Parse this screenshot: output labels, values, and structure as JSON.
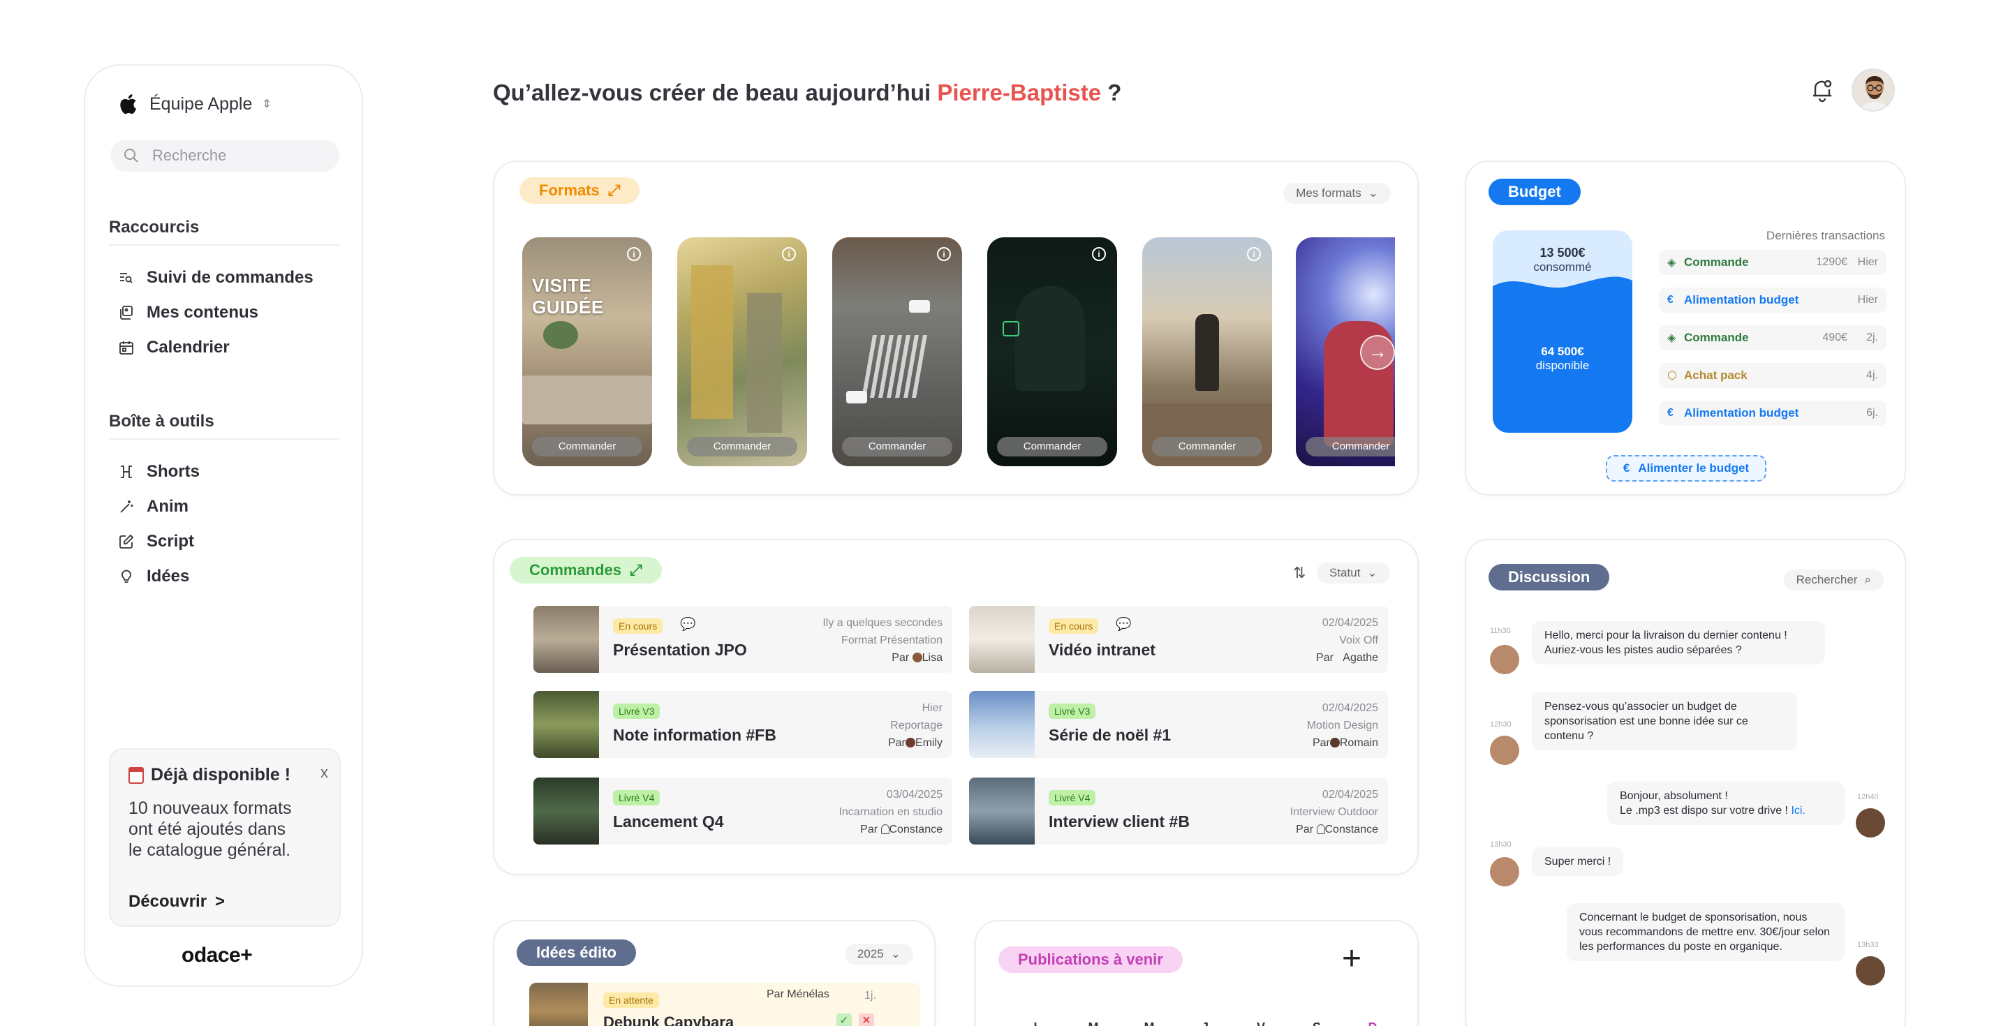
{
  "sidebar": {
    "team_name": "Équipe Apple",
    "search_placeholder": "Recherche",
    "shortcuts_title": "Raccourcis",
    "shortcuts": [
      {
        "label": "Suivi de commandes",
        "icon": "list-search-icon"
      },
      {
        "label": "Mes contenus",
        "icon": "stack-icon"
      },
      {
        "label": "Calendrier",
        "icon": "calendar-icon"
      }
    ],
    "tools_title": "Boîte à outils",
    "tools": [
      {
        "label": "Shorts",
        "icon": "shorts-icon"
      },
      {
        "label": "Anim",
        "icon": "magic-wand-icon"
      },
      {
        "label": "Script",
        "icon": "edit-icon"
      },
      {
        "label": "Idées",
        "icon": "lightbulb-icon"
      }
    ],
    "promo": {
      "title": "Déjà disponible !",
      "close": "x",
      "text": "10 nouveaux formats ont été ajoutés dans le catalogue général.",
      "link": "Découvrir",
      "link_arrow": ">"
    },
    "logo": "odace+"
  },
  "header": {
    "greeting": "Qu’allez-vous créer de beau aujourd’hui",
    "name": "Pierre-Baptiste",
    "suffix": "?"
  },
  "formats": {
    "title": "Formats",
    "filter": "Mes formats",
    "items": [
      {
        "overlay_title": "VISITE GUIDÉE",
        "cta": "Commander"
      },
      {
        "overlay_title": "",
        "cta": "Commander"
      },
      {
        "overlay_title": "",
        "cta": "Commander"
      },
      {
        "overlay_title": "",
        "cta": "Commander"
      },
      {
        "overlay_title": "",
        "cta": "Commander"
      },
      {
        "overlay_title": "",
        "cta": "Commander"
      }
    ]
  },
  "budget": {
    "title": "Budget",
    "consumed_amount": "13 500€",
    "consumed_label": "consommé",
    "available_amount": "64 500€",
    "available_label": "disponible",
    "transactions_title": "Dernières transactions",
    "transactions": [
      {
        "label": "Commande",
        "amount": "1290€",
        "when": "Hier",
        "color": "#2d7a3e",
        "icon": "diamond-icon"
      },
      {
        "label": "Alimentation budget",
        "amount": "",
        "when": "Hier",
        "color": "#1479f0",
        "icon": "euro-icon"
      },
      {
        "label": "Commande",
        "amount": "490€",
        "when": "2j.",
        "color": "#2d7a3e",
        "icon": "diamond-icon"
      },
      {
        "label": "Achat pack",
        "amount": "",
        "when": "4j.",
        "color": "#b38a2e",
        "icon": "package-icon"
      },
      {
        "label": "Alimentation budget",
        "amount": "",
        "when": "6j.",
        "color": "#1479f0",
        "icon": "euro-icon"
      }
    ],
    "feed_button": "Alimenter le budget"
  },
  "orders": {
    "title": "Commandes",
    "filter": "Statut",
    "items": [
      {
        "status": "En cours",
        "title": "Présentation JPO",
        "date": "Ily a quelques secondes",
        "format": "Format Présentation",
        "by_prefix": "Par",
        "by": "Lisa"
      },
      {
        "status": "En cours",
        "title": "Vidéo intranet",
        "date": "02/04/2025",
        "format": "Voix Off",
        "by_prefix": "Par",
        "by": "Agathe"
      },
      {
        "status": "Livré V3",
        "title": "Note information #FB",
        "date": "Hier",
        "format": "Reportage",
        "by_prefix": "Par",
        "by": "Emily"
      },
      {
        "status": "Livré V3",
        "title": "Série de noël #1",
        "date": "02/04/2025",
        "format": "Motion Design",
        "by_prefix": "Par",
        "by": "Romain"
      },
      {
        "status": "Livré V4",
        "title": "Lancement Q4",
        "date": "03/04/2025",
        "format": "Incarnation en studio",
        "by_prefix": "Par",
        "by": "Constance"
      },
      {
        "status": "Livré V4",
        "title": "Interview client #B",
        "date": "02/04/2025",
        "format": "Interview Outdoor",
        "by_prefix": "Par",
        "by": "Constance"
      }
    ]
  },
  "discussion": {
    "title": "Discussion",
    "search_label": "Rechercher",
    "messages": [
      {
        "time": "11h30",
        "from": "other",
        "text": "Hello, merci pour la livraison du dernier contenu ! Auriez-vous les pistes audio séparées ?"
      },
      {
        "time": "12h30",
        "from": "other",
        "text": "Pensez-vous qu’associer un budget de sponsorisation est une bonne idée sur ce contenu ?"
      },
      {
        "time": "12h40",
        "from": "me",
        "text": "Bonjour, absolument !",
        "text2": "Le .mp3 est dispo sur votre drive !",
        "link": "Ici."
      },
      {
        "time": "13h30",
        "from": "other",
        "text": "Super merci !"
      },
      {
        "time": "13h33",
        "from": "me",
        "text": "Concernant le budget de sponsorisation, nous vous recommandons de mettre env. 30€/jour selon les performances du poste en organique."
      }
    ]
  },
  "ideas": {
    "title": "Idées édito",
    "year": "2025",
    "item": {
      "status": "En attente",
      "title": "Debunk Capybara",
      "by_prefix": "Par",
      "by": "Ménélas",
      "when": "1j."
    }
  },
  "publications": {
    "title": "Publications à venir",
    "days": [
      "L",
      "M",
      "M",
      "J",
      "V",
      "S",
      "D"
    ]
  },
  "colors": {
    "accent_red": "#e9534f",
    "formats_orange": "#f08a00",
    "orders_green": "#2d9b3a",
    "budget_blue": "#1479f0",
    "publications_pink": "#c23fb5"
  }
}
